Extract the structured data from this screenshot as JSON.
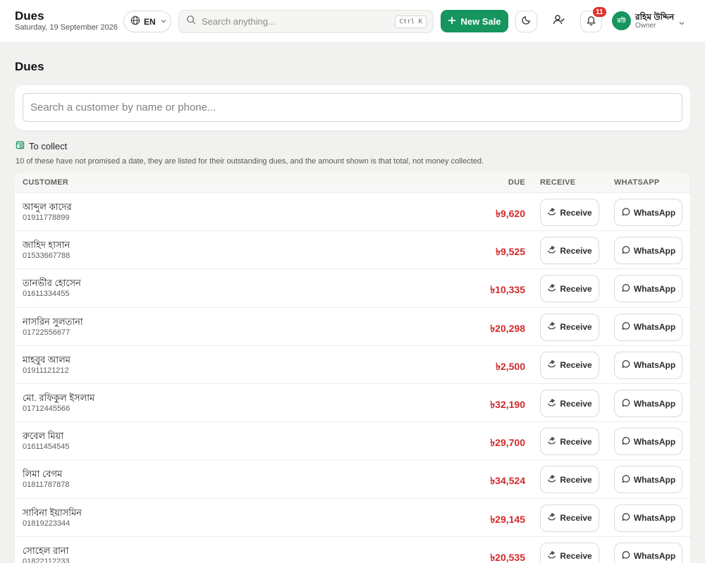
{
  "header": {
    "title": "Dues",
    "date": "Saturday, 19 September 2026",
    "language": "EN",
    "search_placeholder": "Search anything...",
    "search_shortcut": "Ctrl K",
    "new_sale_label": "New Sale",
    "notification_count": "11",
    "user": {
      "initials": "রউ",
      "name": "রহিম উদ্দিন",
      "role": "Owner"
    },
    "accent_color": "#16955e"
  },
  "page": {
    "title": "Dues",
    "customer_search_placeholder": "Search a customer by name or phone...",
    "section_title": "To collect",
    "section_note": "10 of these have not promised a date, they are listed for their outstanding dues, and the amount shown is that total, not money collected."
  },
  "table": {
    "columns": {
      "customer": "CUSTOMER",
      "due": "DUE",
      "receive": "RECEIVE",
      "whatsapp": "WHATSAPP"
    },
    "receive_label": "Receive",
    "whatsapp_label": "WhatsApp",
    "due_color": "#d12a2a",
    "rows": [
      {
        "name": "আব্দুল কাদের",
        "phone": "01911778899",
        "due": "৳9,620"
      },
      {
        "name": "জাহিদ হাসান",
        "phone": "01533667788",
        "due": "৳9,525"
      },
      {
        "name": "তানভীর হোসেন",
        "phone": "01611334455",
        "due": "৳10,335"
      },
      {
        "name": "নাসরিন সুলতানা",
        "phone": "01722556677",
        "due": "৳20,298"
      },
      {
        "name": "মাহবুব আলম",
        "phone": "01911121212",
        "due": "৳2,500"
      },
      {
        "name": "মো. রফিকুল ইসলাম",
        "phone": "01712445566",
        "due": "৳32,190"
      },
      {
        "name": "রুবেল মিয়া",
        "phone": "01611454545",
        "due": "৳29,700"
      },
      {
        "name": "লিমা বেগম",
        "phone": "01811787878",
        "due": "৳34,524"
      },
      {
        "name": "সাবিনা ইয়াসমিন",
        "phone": "01819223344",
        "due": "৳29,145"
      },
      {
        "name": "সোহেল রানা",
        "phone": "01822112233",
        "due": "৳20,535"
      }
    ]
  }
}
